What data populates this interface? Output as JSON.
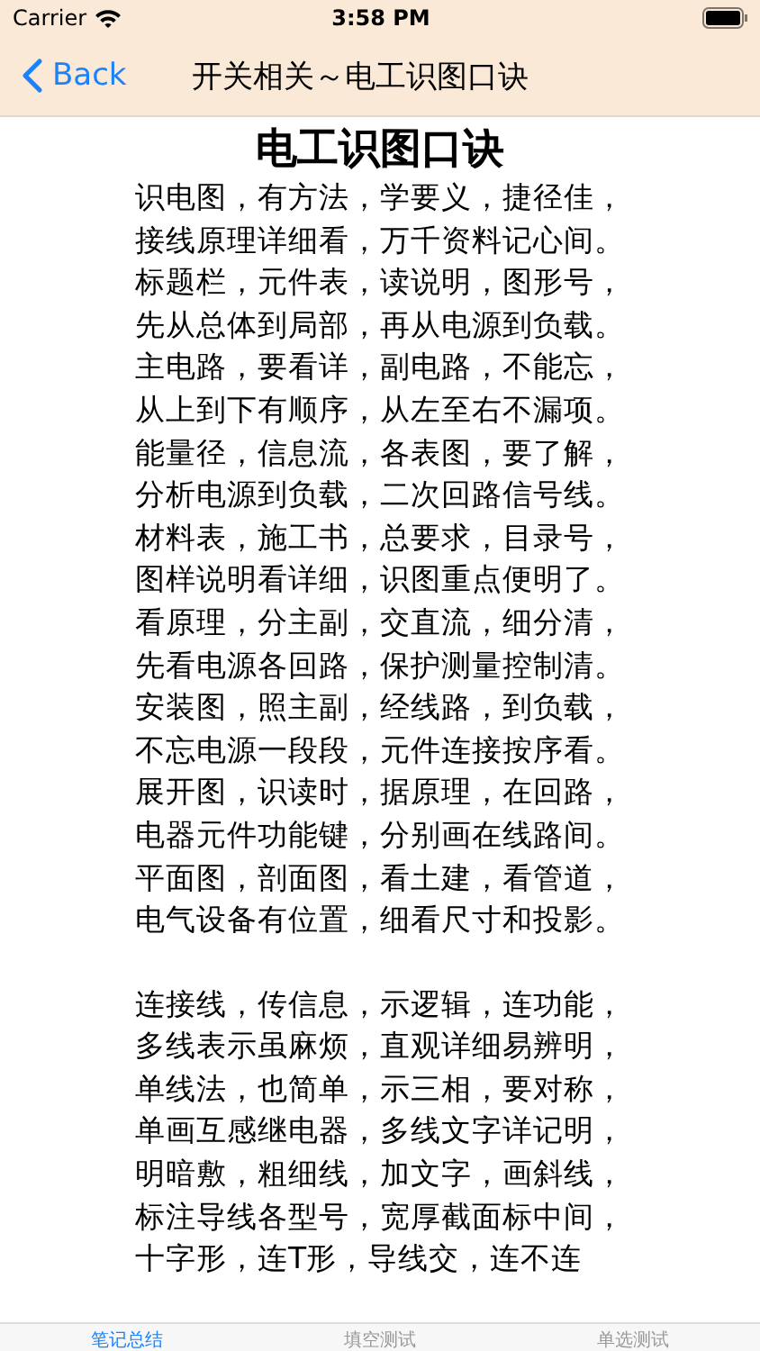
{
  "status_bar": {
    "carrier": "Carrier",
    "time": "3:58 PM"
  },
  "nav_bar": {
    "back": "Back",
    "title": "开关相关～电工识图口诀"
  },
  "article": {
    "title": "电工识图口诀",
    "stanzas": [
      [
        "识电图，有方法，学要义，捷径佳，",
        "接线原理详细看，万千资料记心间。",
        "标题栏，元件表，读说明，图形号，",
        "先从总体到局部，再从电源到负载。",
        "主电路，要看详，副电路，不能忘，",
        "从上到下有顺序，从左至右不漏项。",
        "能量径，信息流，各表图，要了解，",
        "分析电源到负载，二次回路信号线。",
        "材料表，施工书，总要求，目录号，",
        "图样说明看详细，识图重点便明了。",
        "看原理，分主副，交直流，细分清，",
        "先看电源各回路，保护测量控制清。",
        "安装图，照主副，经线路，到负载，",
        "不忘电源一段段，元件连接按序看。",
        "展开图，识读时，据原理，在回路，",
        "电器元件功能键，分别画在线路间。",
        "平面图，剖面图，看土建，看管道，",
        "电气设备有位置，细看尺寸和投影。"
      ],
      [
        "连接线，传信息，示逻辑，连功能，",
        "多线表示虽麻烦，直观详细易辨明，",
        "单线法，也简单，示三相，要对称，",
        "单画互感继电器，多线文字详记明，",
        "明暗敷，粗细线，加文字，画斜线，",
        "标注导线各型号，宽厚截面标中间，",
        "十字形，连T形，导线交，连不连"
      ]
    ]
  },
  "tabs": [
    {
      "label": "笔记总结",
      "selected": true
    },
    {
      "label": "填空测试",
      "selected": false
    },
    {
      "label": "单选测试",
      "selected": false
    }
  ]
}
